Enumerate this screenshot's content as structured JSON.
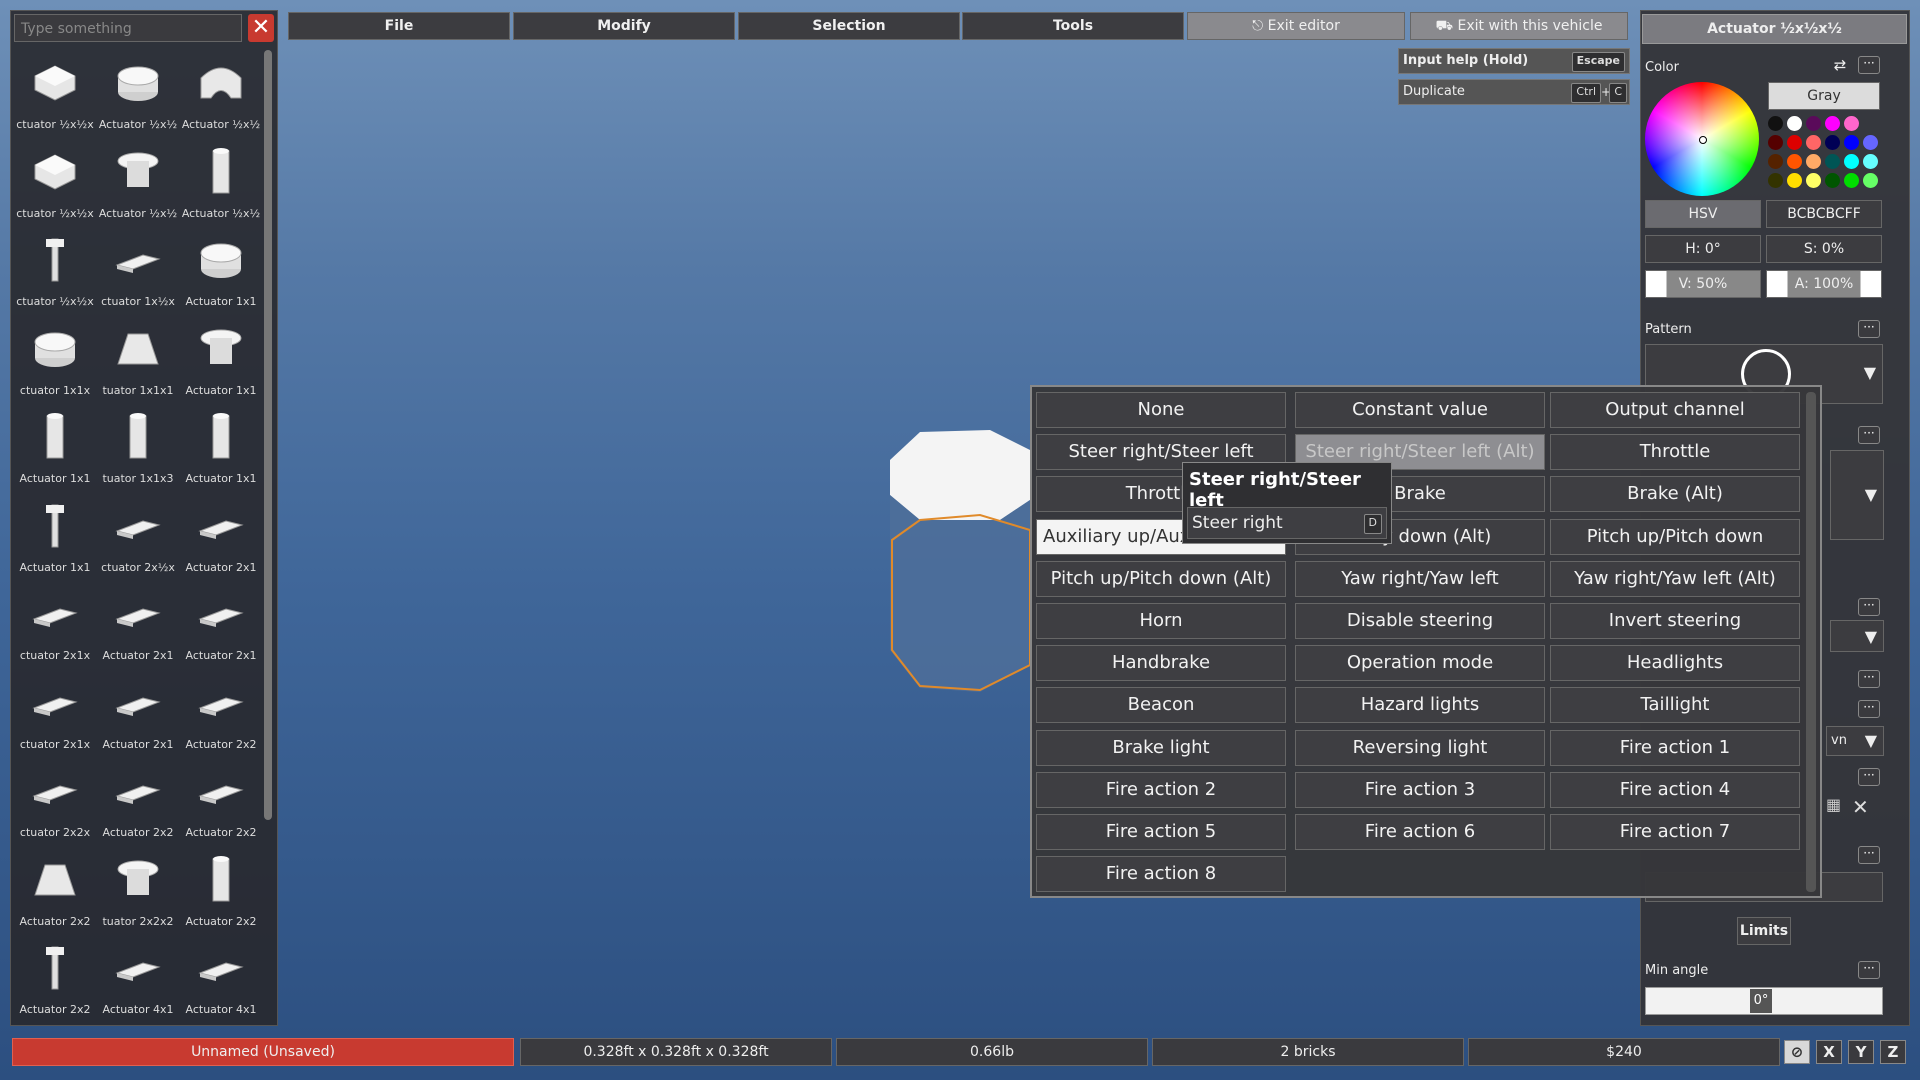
{
  "palette": {
    "search_placeholder": "Type something",
    "bricks": [
      {
        "label": "ctuator ½x½x",
        "icon": "block-icon"
      },
      {
        "label": "Actuator ½x½",
        "icon": "round-block-icon"
      },
      {
        "label": "Actuator ½x½",
        "icon": "arch-icon"
      },
      {
        "label": "ctuator ½x½x",
        "icon": "block-icon"
      },
      {
        "label": "Actuator ½x½",
        "icon": "mushroom-icon"
      },
      {
        "label": "Actuator ½x½",
        "icon": "pillar-icon"
      },
      {
        "label": "ctuator ½x½x",
        "icon": "pin-icon"
      },
      {
        "label": "ctuator 1x½x",
        "icon": "plate-icon"
      },
      {
        "label": "Actuator 1x1",
        "icon": "round-block-icon"
      },
      {
        "label": "ctuator 1x1x",
        "icon": "round-block-icon"
      },
      {
        "label": "tuator 1x1x1",
        "icon": "wedge-icon"
      },
      {
        "label": "Actuator 1x1",
        "icon": "mushroom-icon"
      },
      {
        "label": "Actuator 1x1",
        "icon": "pillar-icon"
      },
      {
        "label": "tuator 1x1x3",
        "icon": "pillar-icon"
      },
      {
        "label": "Actuator 1x1",
        "icon": "pillar-icon"
      },
      {
        "label": "Actuator 1x1",
        "icon": "pin-icon"
      },
      {
        "label": "ctuator 2x½x",
        "icon": "plate-icon"
      },
      {
        "label": "Actuator 2x1",
        "icon": "plate-icon"
      },
      {
        "label": "ctuator 2x1x",
        "icon": "plate-icon"
      },
      {
        "label": "Actuator 2x1",
        "icon": "plate-icon"
      },
      {
        "label": "Actuator 2x1",
        "icon": "plate-icon"
      },
      {
        "label": "ctuator 2x1x",
        "icon": "plate-icon"
      },
      {
        "label": "Actuator 2x1",
        "icon": "plate-icon"
      },
      {
        "label": "Actuator 2x2",
        "icon": "plate-icon"
      },
      {
        "label": "ctuator 2x2x",
        "icon": "plate-icon"
      },
      {
        "label": "Actuator 2x2",
        "icon": "plate-icon"
      },
      {
        "label": "Actuator 2x2",
        "icon": "plate-icon"
      },
      {
        "label": "Actuator 2x2",
        "icon": "wedge-icon"
      },
      {
        "label": "tuator 2x2x2",
        "icon": "mushroom-icon"
      },
      {
        "label": "Actuator 2x2",
        "icon": "pillar-icon"
      },
      {
        "label": "Actuator 2x2",
        "icon": "pin-icon"
      },
      {
        "label": "Actuator 4x1",
        "icon": "plate-icon"
      },
      {
        "label": "Actuator 4x1",
        "icon": "plate-icon"
      }
    ]
  },
  "menu": {
    "file": "File",
    "modify": "Modify",
    "selection": "Selection",
    "tools": "Tools",
    "exit_editor": "Exit editor",
    "exit_vehicle": "Exit with this vehicle"
  },
  "help": {
    "input_help": "Input help (Hold)",
    "input_help_key": "Escape",
    "duplicate": "Duplicate",
    "duplicate_key1": "Ctrl",
    "duplicate_plus": "+",
    "duplicate_key2": "C"
  },
  "right_panel": {
    "title": "Actuator ½x½x½",
    "color_label": "Color",
    "color_name": "Gray",
    "mode": "HSV",
    "hex": "BCBCBCFF",
    "h": "H: 0°",
    "s": "S: 0%",
    "v": "V: 50%",
    "a": "A: 100%",
    "pattern_label": "Pattern",
    "partial_label": "vn",
    "limits": "Limits",
    "min_angle_label": "Min angle",
    "min_angle_value": "0°",
    "swatches": [
      "#111111",
      "#ffffff",
      "#5a0a5a",
      "#ff00ff",
      "#ff66cc",
      "#550000",
      "#dd0000",
      "#ff6666",
      "#000055",
      "#0000ff",
      "#6666ff",
      "#552200",
      "#ff5500",
      "#ffaa66",
      "#005555",
      "#00ffff",
      "#66ffff",
      "#333300",
      "#ffdd00",
      "#ffff66",
      "#005500",
      "#00dd00",
      "#66ff66"
    ]
  },
  "popup": {
    "options": [
      "None",
      "Constant value",
      "Output channel",
      "Steer right/Steer left",
      "Steer right/Steer left (Alt)",
      "Throttle",
      "Throttle",
      "Brake",
      "Brake (Alt)",
      "Auxiliary up/Aux",
      "iliary down (Alt)",
      "Pitch up/Pitch down",
      "Pitch up/Pitch down (Alt)",
      "Yaw right/Yaw left",
      "Yaw right/Yaw left (Alt)",
      "Horn",
      "Disable steering",
      "Invert steering",
      "Handbrake",
      "Operation mode",
      "Headlights",
      "Beacon",
      "Hazard lights",
      "Taillight",
      "Brake light",
      "Reversing light",
      "Fire action 1",
      "Fire action 2",
      "Fire action 3",
      "Fire action 4",
      "Fire action 5",
      "Fire action 6",
      "Fire action 7",
      "Fire action 8"
    ],
    "submenu_title": "Steer right/Steer left",
    "submenu_item": "Steer right",
    "submenu_key": "D"
  },
  "status": {
    "name": "Unnamed (Unsaved)",
    "size": "0.328ft x 0.328ft x 0.328ft",
    "weight": "0.66lb",
    "bricks": "2 bricks",
    "price": "$240",
    "icons": [
      "X",
      "Y",
      "Z"
    ]
  },
  "colors": {
    "accent_red": "#c83a30",
    "selection_orange": "#e08a2a"
  }
}
